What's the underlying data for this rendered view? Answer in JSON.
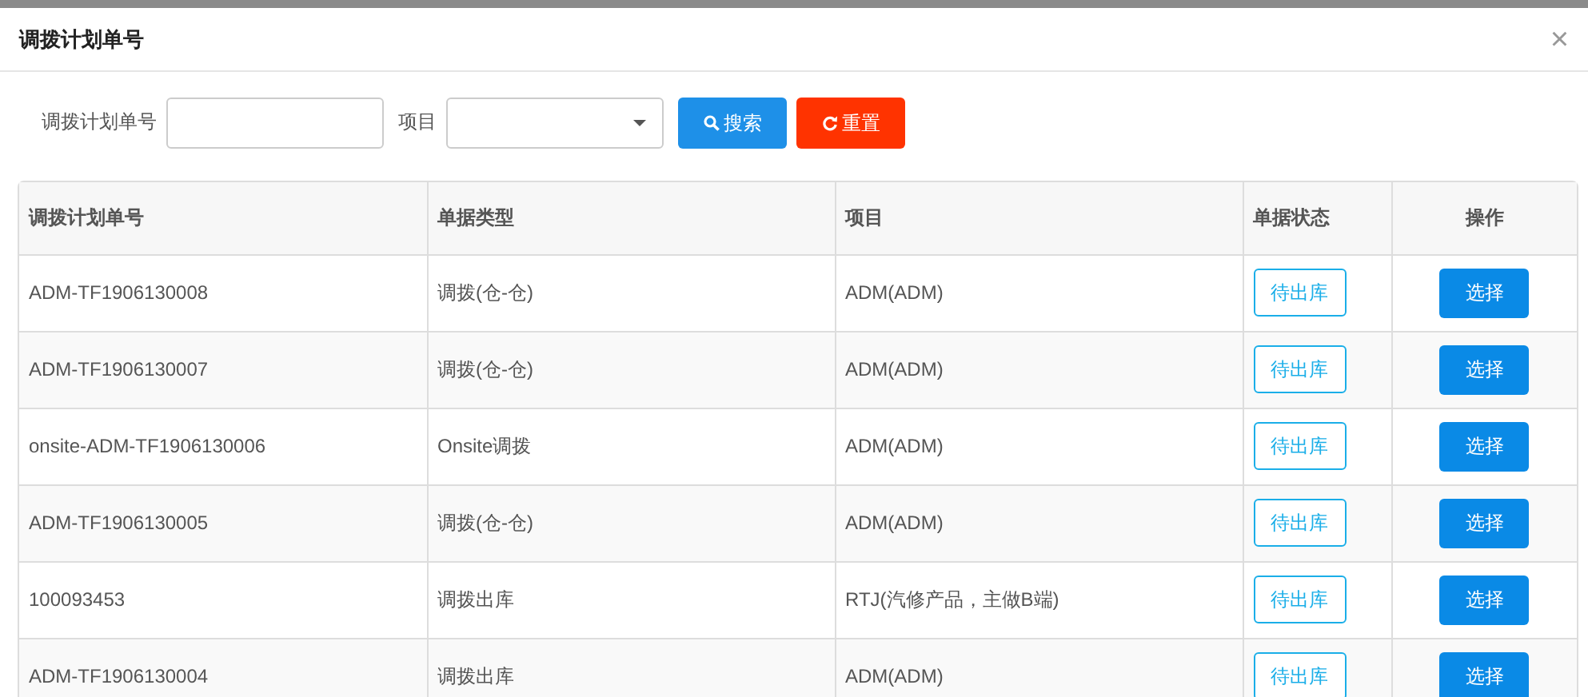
{
  "dialog": {
    "title": "调拨计划单号",
    "close": "×"
  },
  "filters": {
    "plan_label": "调拨计划单号",
    "project_label": "项目",
    "search_button": "搜索",
    "reset_button": "重置"
  },
  "table": {
    "columns": [
      "调拨计划单号",
      "单据类型",
      "项目",
      "单据状态",
      "操作"
    ],
    "rows": [
      {
        "plan_no": "ADM-TF1906130008",
        "type": "调拨(仓-仓)",
        "project": "ADM(ADM)",
        "status": "待出库",
        "action": "选择"
      },
      {
        "plan_no": "ADM-TF1906130007",
        "type": "调拨(仓-仓)",
        "project": "ADM(ADM)",
        "status": "待出库",
        "action": "选择"
      },
      {
        "plan_no": "onsite-ADM-TF1906130006",
        "type": "Onsite调拨",
        "project": "ADM(ADM)",
        "status": "待出库",
        "action": "选择"
      },
      {
        "plan_no": "ADM-TF1906130005",
        "type": "调拨(仓-仓)",
        "project": "ADM(ADM)",
        "status": "待出库",
        "action": "选择"
      },
      {
        "plan_no": "100093453",
        "type": "调拨出库",
        "project": "RTJ(汽修产品，主做B端)",
        "status": "待出库",
        "action": "选择"
      },
      {
        "plan_no": "ADM-TF1906130004",
        "type": "调拨出库",
        "project": "ADM(ADM)",
        "status": "待出库",
        "action": "选择"
      }
    ]
  }
}
